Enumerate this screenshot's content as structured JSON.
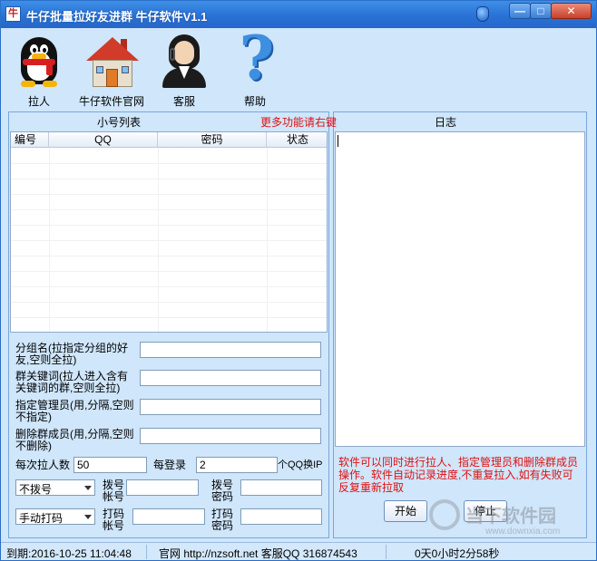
{
  "window": {
    "title": "牛仔批量拉好友进群 牛仔软件V1.1",
    "app_icon_glyph": "牛",
    "controls": {
      "minimize": "—",
      "maximize": "□",
      "close": "✕"
    }
  },
  "toolbar": {
    "items": [
      {
        "label": "拉人",
        "icon": "penguin-icon"
      },
      {
        "label": "牛仔软件官网",
        "icon": "house-icon"
      },
      {
        "label": "客服",
        "icon": "support-person-icon"
      },
      {
        "label": "帮助",
        "icon": "question-mark-icon"
      }
    ]
  },
  "headers": {
    "account_list": "小号列表",
    "more_functions": "更多功能请右键",
    "log": "日志"
  },
  "table": {
    "columns": [
      "编号",
      "QQ",
      "密码",
      "状态"
    ],
    "rows": []
  },
  "form": {
    "group_name_label": "分组名(拉指定分组的好友,空则全拉)",
    "group_name_value": "",
    "keyword_label": "群关键词(拉人进入含有关键词的群,空则全拉)",
    "keyword_value": "",
    "admin_label": "指定管理员(用,分隔,空则不指定)",
    "admin_value": "",
    "remove_label": "删除群成员(用,分隔,空则不删除)",
    "remove_value": "",
    "per_pull_label": "每次拉人数",
    "per_pull_value": "50",
    "per_login_label": "每登录",
    "per_login_value": "2",
    "switch_ip_label": "个QQ换IP",
    "dial_select": "不拨号",
    "dial_account_label": "拨号帐号",
    "dial_account_value": "",
    "dial_password_label": "拨号密码",
    "dial_password_value": "",
    "captcha_select": "手动打码",
    "captcha_account_label": "打码帐号",
    "captcha_account_value": "",
    "captcha_password_label": "打码密码",
    "captcha_password_value": ""
  },
  "log": {
    "notice": "软件可以同时进行拉人、指定管理员和删除群成员操作。软件自动记录进度,不重复拉入,如有失败可反复重新拉取"
  },
  "buttons": {
    "start": "开始",
    "stop": "停止"
  },
  "status": {
    "expiry": "到期:2016-10-25 11:04:48",
    "site": "官网 http://nzsoft.net 客服QQ 316874543",
    "elapsed": "0天0小时2分58秒"
  },
  "watermark": {
    "text": "当下软件园",
    "url": "www.downxia.com"
  },
  "colors": {
    "window_bg": "#cfe6fb",
    "title_bar": "#2a72d6",
    "notice_text": "#e01010",
    "border": "#7aa7d9"
  }
}
